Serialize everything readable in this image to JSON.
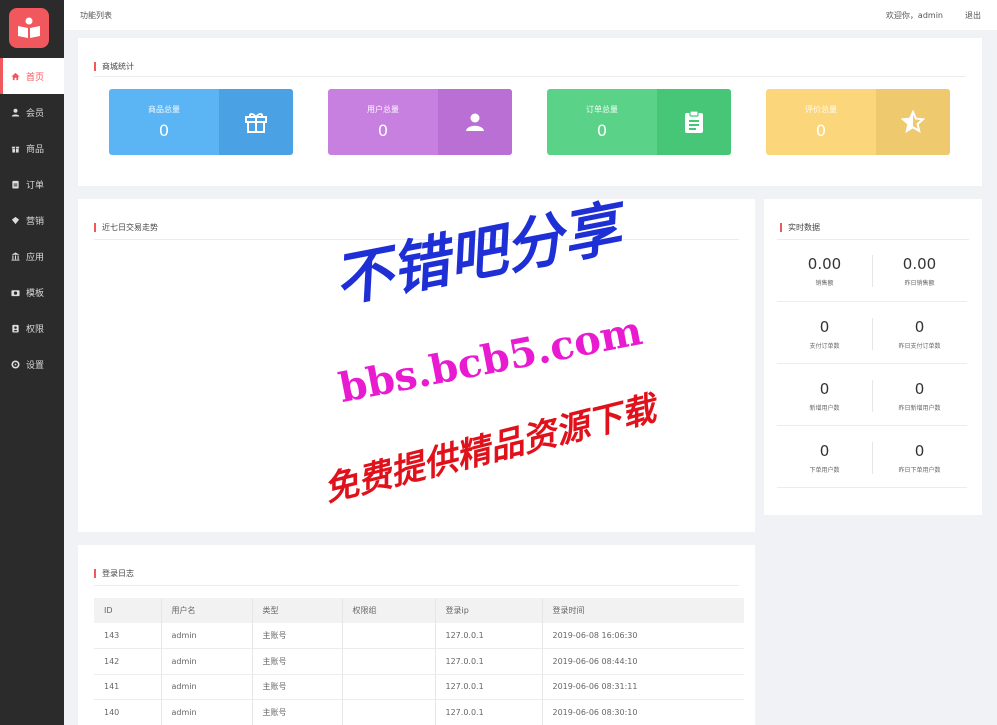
{
  "header": {
    "breadcrumb": "功能列表",
    "welcome": "欢迎你，admin",
    "logout": "退出"
  },
  "sidebar": {
    "items": [
      {
        "label": "首页",
        "icon": "home-icon",
        "active": true
      },
      {
        "label": "会员",
        "icon": "user-icon"
      },
      {
        "label": "商品",
        "icon": "gift-icon"
      },
      {
        "label": "订单",
        "icon": "order-icon"
      },
      {
        "label": "营销",
        "icon": "marketing-icon"
      },
      {
        "label": "应用",
        "icon": "bank-icon"
      },
      {
        "label": "模板",
        "icon": "camera-icon"
      },
      {
        "label": "权限",
        "icon": "lock-icon"
      },
      {
        "label": "设置",
        "icon": "gear-icon"
      }
    ]
  },
  "stats": {
    "title": "商城统计",
    "cards": [
      {
        "label": "商品总量",
        "value": "0",
        "icon": "gift-icon",
        "color": "#5bb4f4",
        "icon_bg": "#4aa2e5"
      },
      {
        "label": "用户总量",
        "value": "0",
        "icon": "user-icon",
        "color": "#c77fe0",
        "icon_bg": "#b96fd3"
      },
      {
        "label": "订单总量",
        "value": "0",
        "icon": "clipboard-icon",
        "color": "#5ad388",
        "icon_bg": "#48c677"
      },
      {
        "label": "评价总量",
        "value": "0",
        "icon": "star-icon",
        "color": "#fcd67a",
        "icon_bg": "#efc96e"
      }
    ]
  },
  "trend": {
    "title": "近七日交易走势"
  },
  "realtime": {
    "title": "实时数据",
    "cells": [
      {
        "value": "0.00",
        "label": "销售额"
      },
      {
        "value": "0.00",
        "label": "昨日销售额"
      },
      {
        "value": "0",
        "label": "支付订单数"
      },
      {
        "value": "0",
        "label": "昨日支付订单数"
      },
      {
        "value": "0",
        "label": "新增用户数"
      },
      {
        "value": "0",
        "label": "昨日新增用户数"
      },
      {
        "value": "0",
        "label": "下单用户数"
      },
      {
        "value": "0",
        "label": "昨日下单用户数"
      }
    ]
  },
  "login_log": {
    "title": "登录日志",
    "columns": [
      "ID",
      "用户名",
      "类型",
      "权限组",
      "登录ip",
      "登录时间"
    ],
    "rows": [
      [
        "143",
        "admin",
        "主账号",
        "",
        "127.0.0.1",
        "2019-06-08 16:06:30"
      ],
      [
        "142",
        "admin",
        "主账号",
        "",
        "127.0.0.1",
        "2019-06-06 08:44:10"
      ],
      [
        "141",
        "admin",
        "主账号",
        "",
        "127.0.0.1",
        "2019-06-06 08:31:11"
      ],
      [
        "140",
        "admin",
        "主账号",
        "",
        "127.0.0.1",
        "2019-06-06 08:30:10"
      ]
    ]
  },
  "watermark": {
    "line1": "不错吧分享",
    "line2": "bbs.bcb5.com",
    "line3": "免费提供精品资源下载",
    "colors": {
      "line1": "#1f2fd6",
      "line2": "#e81bd1",
      "line3": "#e0111b"
    }
  }
}
